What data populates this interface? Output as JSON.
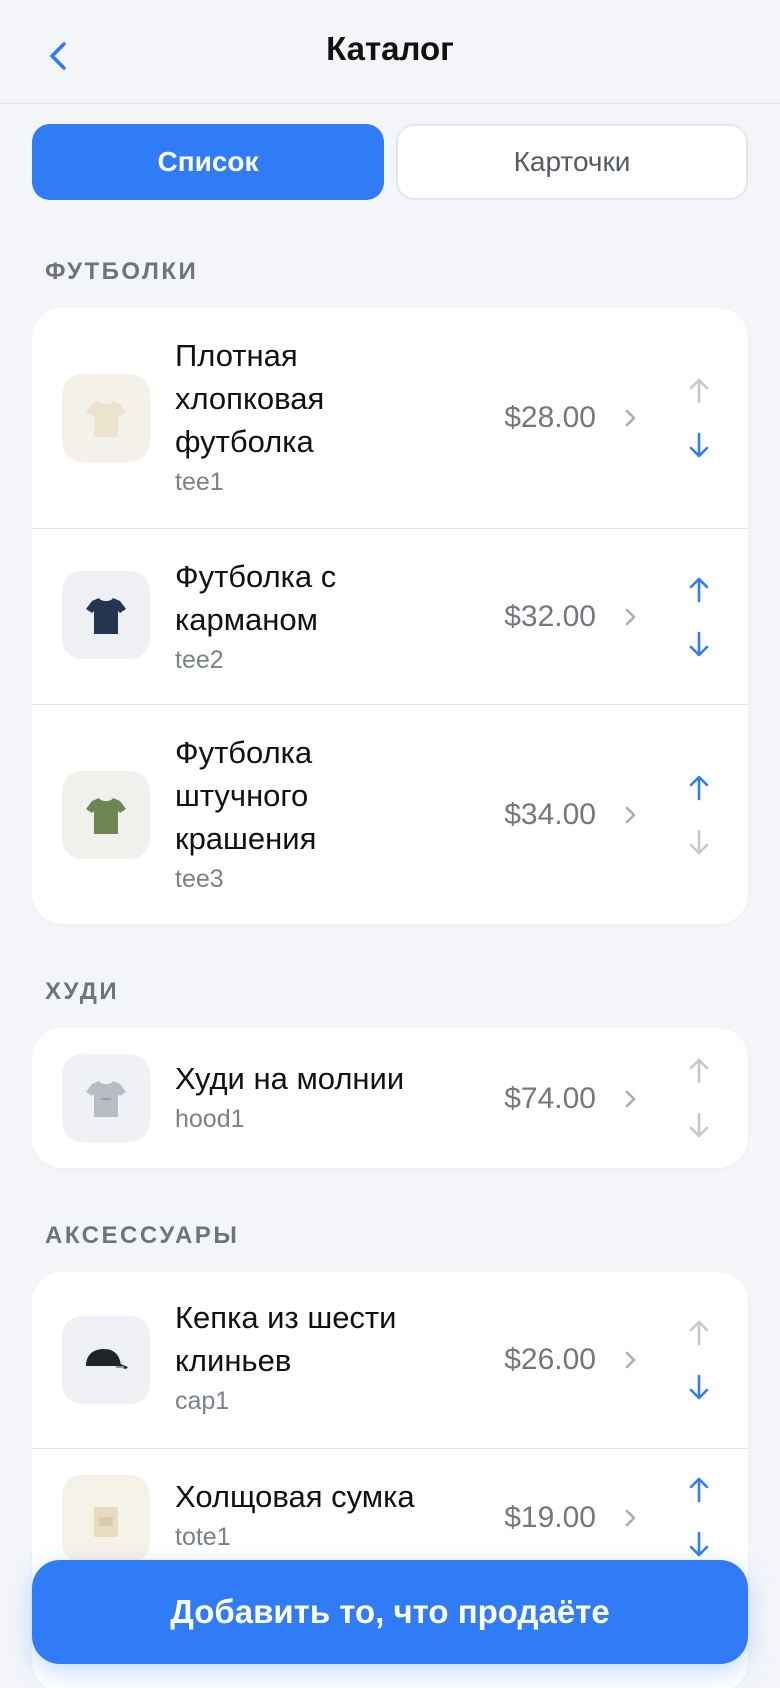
{
  "nav": {
    "title": "Каталог"
  },
  "view_toggle": {
    "list_label": "Список",
    "cards_label": "Карточки",
    "selected": "Список"
  },
  "colors": {
    "accent": "#2f7cf6",
    "arrow_disabled": "#c5c8ce"
  },
  "sections": [
    {
      "title": "ФУТБОЛКИ",
      "items": [
        {
          "name": [
            "Плотная",
            "хлопковая",
            "футболка"
          ],
          "sku": "tee1",
          "price": "$28.00",
          "icon": "tshirt-icon",
          "icon_color": "#ece3cf",
          "thumb_bg": "#f4f1ea",
          "can_move_up": false,
          "can_move_down": true
        },
        {
          "name": [
            "Футболка с",
            "карманом"
          ],
          "sku": "tee2",
          "price": "$32.00",
          "icon": "tshirt-icon",
          "icon_color": "#243552",
          "thumb_bg": "#eef0f4",
          "can_move_up": true,
          "can_move_down": true
        },
        {
          "name": [
            "Футболка",
            "штучного",
            "крашения"
          ],
          "sku": "tee3",
          "price": "$34.00",
          "icon": "tshirt-icon",
          "icon_color": "#6e8553",
          "thumb_bg": "#f0f1ec",
          "can_move_up": true,
          "can_move_down": false
        }
      ]
    },
    {
      "title": "ХУДИ",
      "items": [
        {
          "name": [
            "Худи на молнии"
          ],
          "sku": "hood1",
          "price": "$74.00",
          "icon": "hoodie-icon",
          "icon_color": "#b8bdc5",
          "thumb_bg": "#f0f1f4",
          "can_move_up": false,
          "can_move_down": false
        }
      ]
    },
    {
      "title": "АКСЕССУАРЫ",
      "items": [
        {
          "name": [
            "Кепка из шести",
            "клиньев"
          ],
          "sku": "cap1",
          "price": "$26.00",
          "icon": "cap-icon",
          "icon_color": "#1f232c",
          "thumb_bg": "#eef0f4",
          "can_move_up": false,
          "can_move_down": true
        },
        {
          "name": [
            "Холщовая сумка"
          ],
          "sku": "tote1",
          "price": "$19.00",
          "icon": "tote-bag-icon",
          "icon_color": "#e6dcc2",
          "thumb_bg": "#f5f2e8",
          "can_move_up": true,
          "can_move_down": true
        }
      ]
    }
  ],
  "cta": {
    "label": "Добавить то, что продаёте"
  }
}
